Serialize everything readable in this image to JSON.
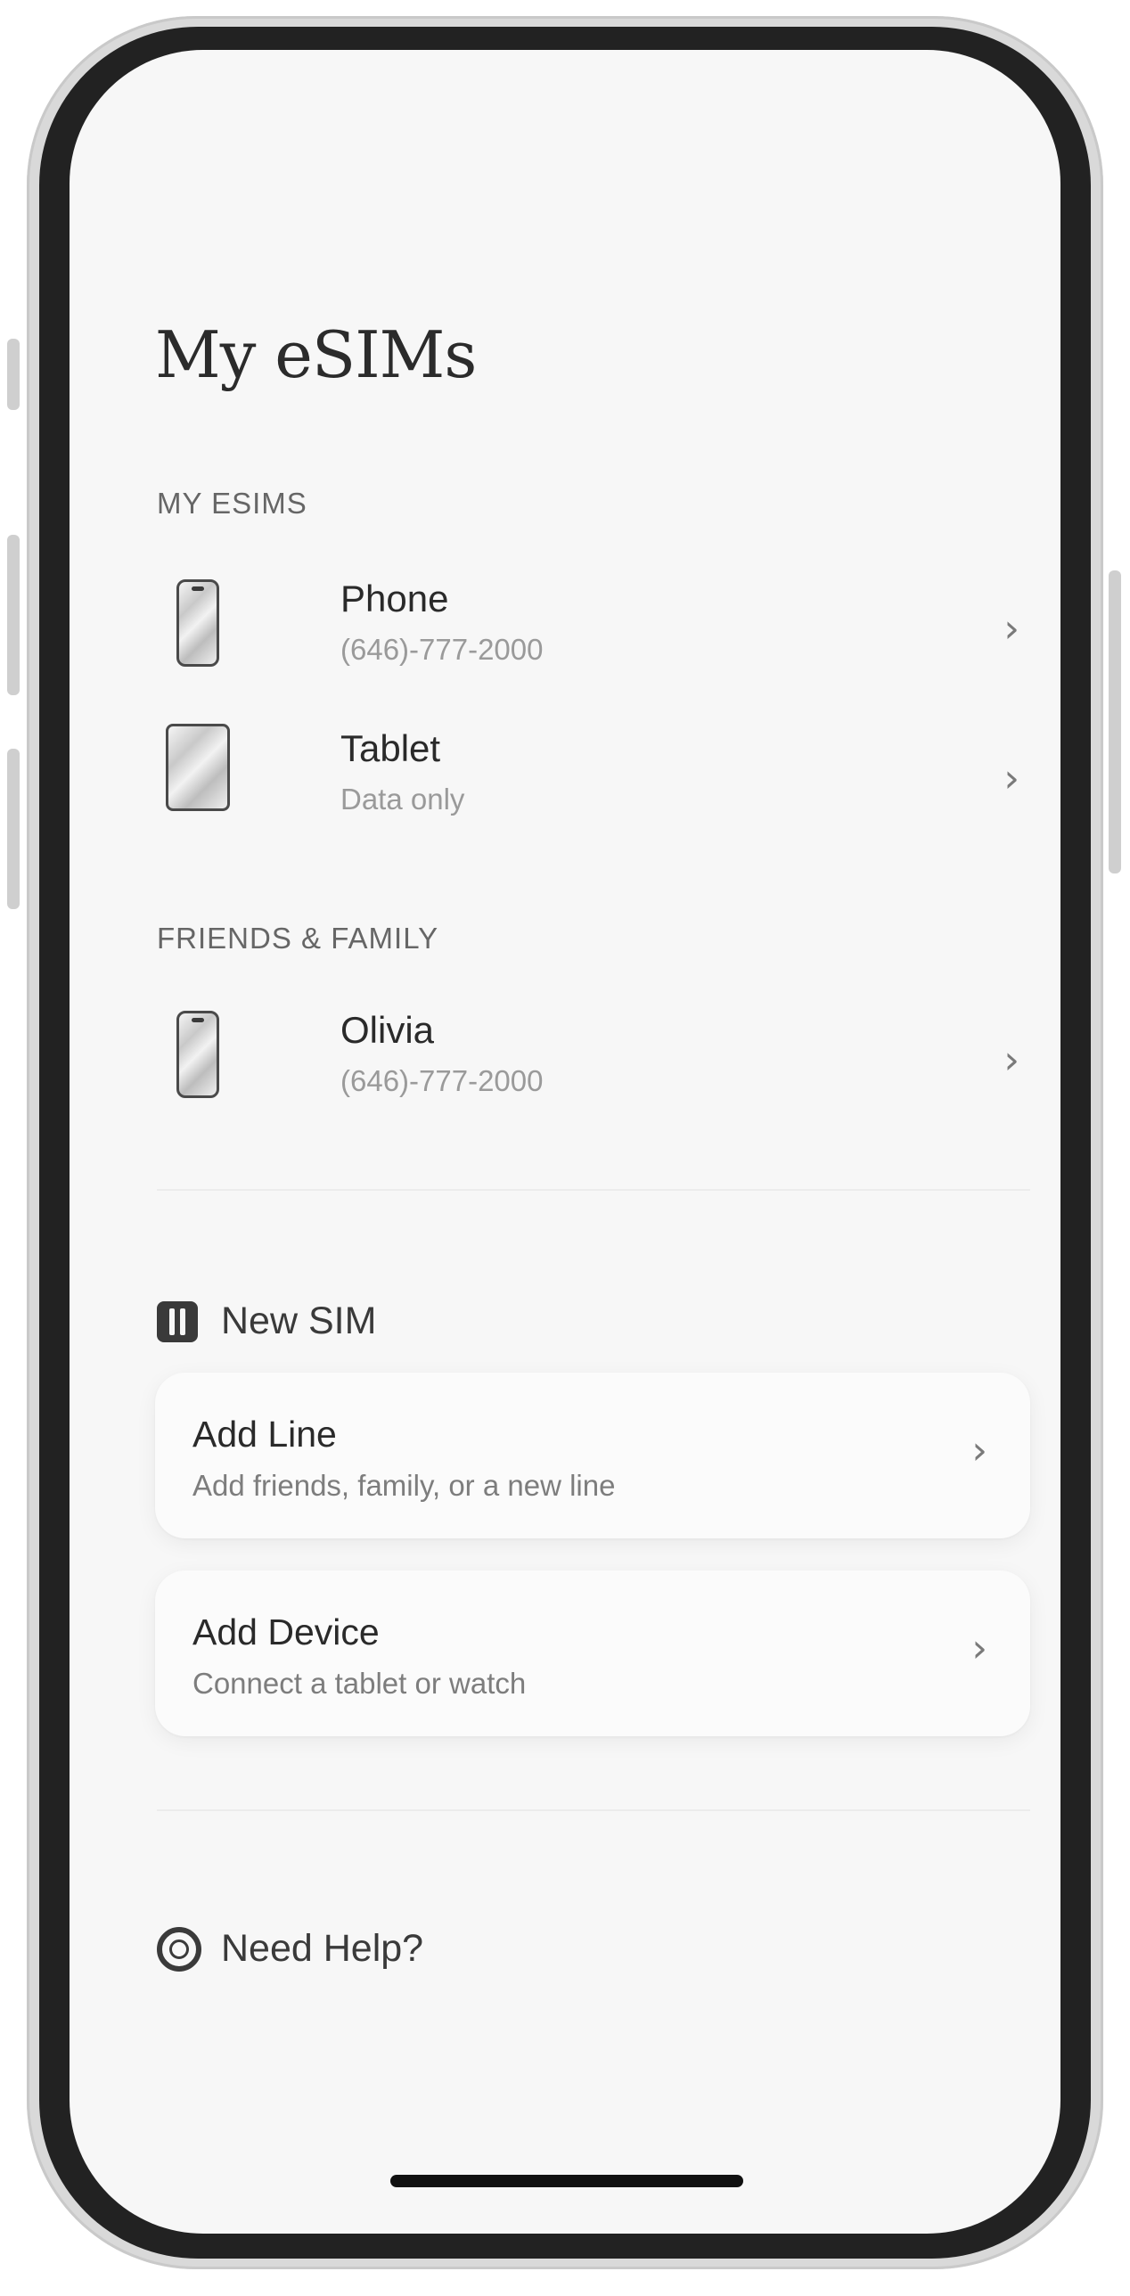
{
  "header": {
    "title": "My eSIMs"
  },
  "my_esims": {
    "heading": "MY  ESIMS",
    "items": [
      {
        "icon": "phone-icon",
        "title": "Phone",
        "subtitle": "(646)-777-2000"
      },
      {
        "icon": "tablet-icon",
        "title": "Tablet",
        "subtitle": "Data only"
      }
    ]
  },
  "friends_family": {
    "heading": "FRIENDS & FAMILY",
    "items": [
      {
        "icon": "phone-icon",
        "title": "Olivia",
        "subtitle": "(646)-777-2000"
      }
    ]
  },
  "new_sim": {
    "icon": "sim-card-icon",
    "heading": "New SIM",
    "cards": [
      {
        "title": "Add Line",
        "subtitle": "Add friends, family, or a new line"
      },
      {
        "title": "Add Device",
        "subtitle": "Connect a tablet or watch"
      }
    ]
  },
  "help": {
    "icon": "lifebuoy-icon",
    "label": "Need Help?"
  },
  "chevron_glyph": "›",
  "colors": {
    "background": "#f7f7f7",
    "text_primary": "#2a2a2a",
    "text_secondary": "#9a9a9a",
    "bezel": "#222222"
  }
}
